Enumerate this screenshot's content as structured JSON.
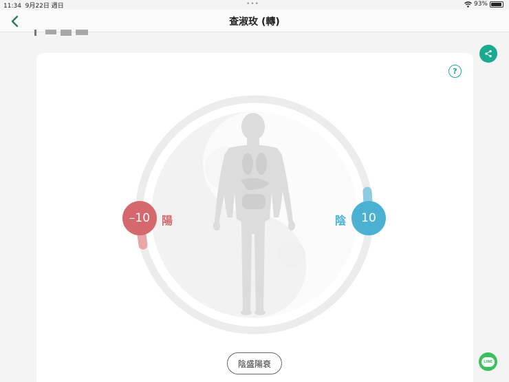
{
  "status_bar": {
    "time": "11:34",
    "date": "9月22日 週日",
    "dots": "•••",
    "battery": "93%",
    "battery_level": 0.93
  },
  "nav": {
    "title": "查淑玫 (轉)"
  },
  "diagram": {
    "yang_value": "–10",
    "yang_label": "陽",
    "yin_value": "10",
    "yin_label": "陰",
    "yang_color": "#d4686d",
    "yin_color": "#4bb1d3"
  },
  "result": {
    "label": "陰盛陽衰"
  },
  "help": {
    "symbol": "?"
  },
  "line": {
    "label": "LINE"
  },
  "colors": {
    "accent": "#1aaa92",
    "line_green": "#3bc15b"
  },
  "icons": [
    "back-arrow-icon",
    "share-icon",
    "help-icon",
    "line-icon",
    "wifi-icon",
    "battery-icon",
    "body-silhouette-icon"
  ]
}
